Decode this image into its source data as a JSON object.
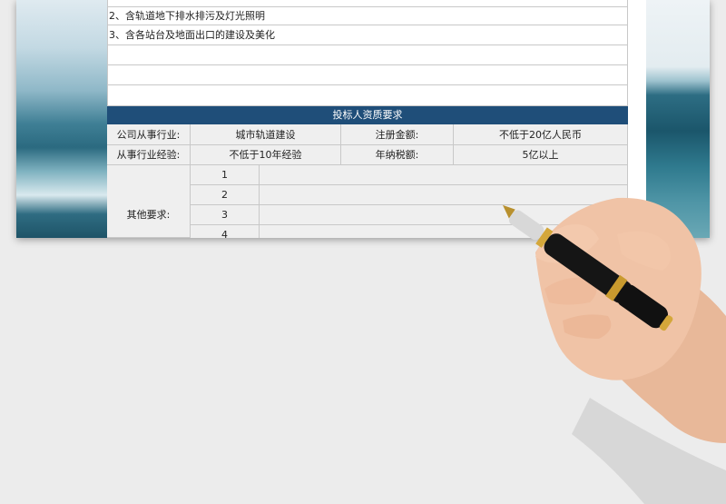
{
  "list": {
    "item2": "2、含轨道地下排水排污及灯光照明",
    "item3": "3、含各站台及地面出口的建设及美化"
  },
  "section_title": "投标人资质要求",
  "qual": {
    "row1": {
      "label1": "公司从事行业:",
      "value1": "城市轨道建设",
      "label2": "注册金额:",
      "value2": "不低于20亿人民币"
    },
    "row2": {
      "label1": "从事行业经验:",
      "value1": "不低于10年经验",
      "label2": "年纳税额:",
      "value2": "5亿以上"
    },
    "other_label": "其他要求:",
    "numbers": [
      "1",
      "2",
      "3",
      "4"
    ]
  },
  "colors": {
    "header": "#1f4e79",
    "grid": "#c8c8c8",
    "cell_bg": "#efefef"
  }
}
